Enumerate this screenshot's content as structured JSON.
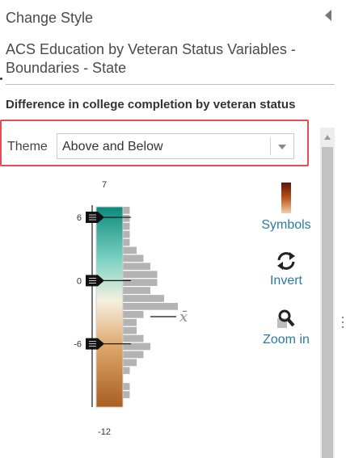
{
  "panel": {
    "title": "Change Style",
    "layer_name": "ACS Education by Veteran Status Variables - Boundaries - State",
    "field_label": "Difference in college completion by veteran status"
  },
  "theme": {
    "label": "Theme",
    "selected": "Above and Below"
  },
  "ramp": {
    "max_label": "7",
    "min_label": "-12",
    "handles": [
      {
        "label": "6",
        "value": 6
      },
      {
        "label": "0",
        "value": 0
      },
      {
        "label": "-6",
        "value": -6
      }
    ],
    "mean_symbol": "x̄",
    "colors": {
      "top": "#0b8a7c",
      "upper_mid": "#7fd3c5",
      "middle": "#f6f0e0",
      "lower_mid": "#dda66a",
      "bottom": "#a85e22",
      "histogram": "#b3b3b3",
      "handle": "#111111"
    },
    "histogram_bins": [
      1,
      1,
      1,
      1,
      1,
      2,
      3,
      4,
      5,
      5,
      4,
      6,
      8,
      3,
      2,
      2,
      3,
      4,
      3,
      2,
      1,
      0,
      1,
      1,
      0
    ]
  },
  "tools": {
    "symbols_label": "Symbols",
    "invert_label": "Invert",
    "zoom_label": "Zoom in",
    "symbols_icon": "color-ramp-swatch-icon",
    "invert_icon": "refresh-icon",
    "zoom_icon": "magnifier-icon"
  }
}
